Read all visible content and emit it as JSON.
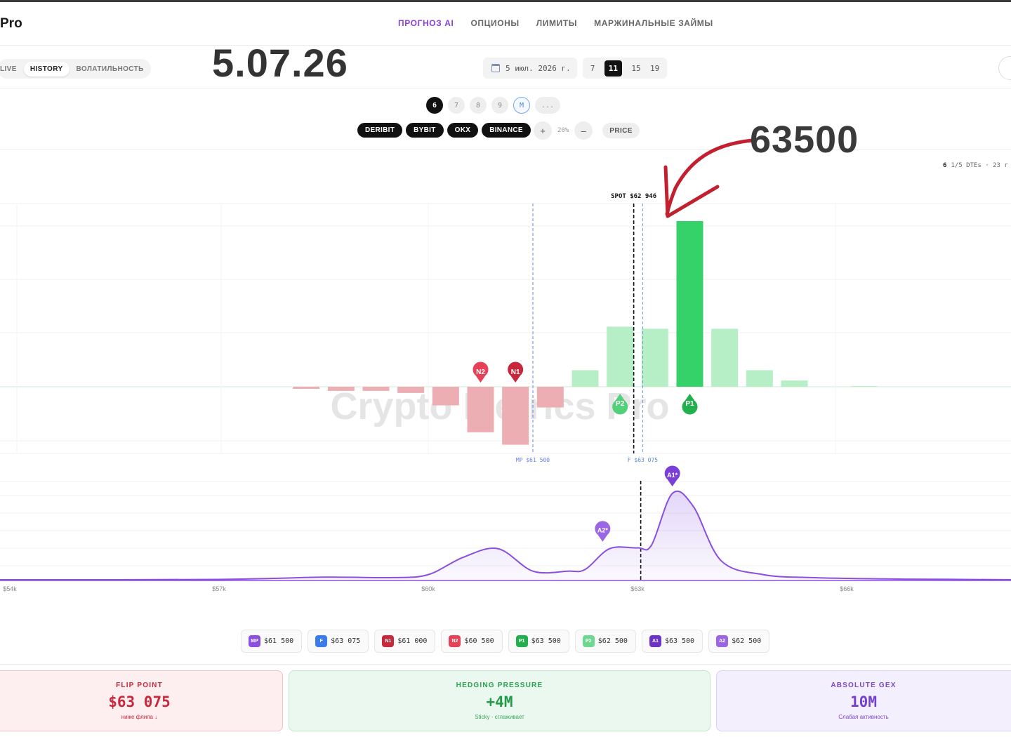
{
  "header": {
    "brand": "Pro",
    "nav": [
      "ПРОГНОЗ AI",
      "ОПЦИОНЫ",
      "ЛИМИТЫ",
      "МАРЖИНАЛЬНЫЕ ЗАЙМЫ"
    ]
  },
  "toolbar": {
    "mode_tabs": [
      "LIVE",
      "HISTORY",
      "ВОЛАТИЛЬНОСТЬ"
    ],
    "overlay_date": "5.07.26",
    "date_value": "5 июл. 2026 г.",
    "days": [
      "7",
      "11",
      "15",
      "19"
    ]
  },
  "controls": {
    "dte_options": [
      "6",
      "7",
      "8",
      "9",
      "M",
      "..."
    ],
    "exchanges": [
      "DERIBIT",
      "BYBIT",
      "OKX",
      "BINANCE"
    ],
    "zoom_plus": "+",
    "zoom_value": "20%",
    "zoom_minus": "–",
    "price_label": "PRICE",
    "meta_dte": "6",
    "meta_text": "1/5 DTEs · 23 r"
  },
  "annotation": {
    "value": "63500"
  },
  "chart_data": {
    "type": "bar",
    "x_unit": "USD strike",
    "x_ticks": [
      54000,
      57000,
      60000,
      63000,
      66000
    ],
    "x_tick_labels": [
      "$54k",
      "$57k",
      "$60k",
      "$63k",
      "$66k"
    ],
    "gex_bars": [
      {
        "strike": 58250,
        "value": -1
      },
      {
        "strike": 58750,
        "value": -2
      },
      {
        "strike": 59250,
        "value": -2
      },
      {
        "strike": 59750,
        "value": -3
      },
      {
        "strike": 60250,
        "value": -9
      },
      {
        "strike": 60750,
        "value": -22
      },
      {
        "strike": 61250,
        "value": -28
      },
      {
        "strike": 61750,
        "value": -10
      },
      {
        "strike": 62250,
        "value": 8
      },
      {
        "strike": 62750,
        "value": 29
      },
      {
        "strike": 63250,
        "value": 28
      },
      {
        "strike": 63750,
        "value": 80
      },
      {
        "strike": 64250,
        "value": 28
      },
      {
        "strike": 64750,
        "value": 8
      },
      {
        "strike": 65250,
        "value": 3
      },
      {
        "strike": 66250,
        "value": 0.3
      }
    ],
    "markers": {
      "spot": {
        "label": "SPOT $62 946",
        "value": 62946
      },
      "max_pain": {
        "label": "MP $61 500",
        "value": 61500
      },
      "flip": {
        "label": "F $63 075",
        "value": 63075
      }
    },
    "pins": [
      {
        "id": "N2",
        "strike": 60750,
        "color": "#e64156"
      },
      {
        "id": "N1",
        "strike": 61250,
        "color": "#c8283c"
      },
      {
        "id": "P2",
        "strike": 62750,
        "color": "#52d07a"
      },
      {
        "id": "P1",
        "strike": 63750,
        "color": "#22b04e"
      }
    ],
    "activity_curve": [
      [
        54000,
        0.0
      ],
      [
        57000,
        0.4
      ],
      [
        58500,
        3
      ],
      [
        59500,
        2.5
      ],
      [
        60000,
        6
      ],
      [
        60500,
        26
      ],
      [
        61000,
        36
      ],
      [
        61500,
        10
      ],
      [
        62000,
        10
      ],
      [
        62250,
        12
      ],
      [
        62600,
        36
      ],
      [
        63000,
        37
      ],
      [
        63200,
        40
      ],
      [
        63500,
        100
      ],
      [
        63800,
        85
      ],
      [
        64200,
        22
      ],
      [
        64800,
        6
      ],
      [
        65500,
        2.5
      ],
      [
        66500,
        1
      ],
      [
        67500,
        0.5
      ]
    ],
    "activity_pins": [
      {
        "id": "A1*",
        "strike": 63500
      },
      {
        "id": "A2*",
        "strike": 62500
      }
    ],
    "watermark": "Crypto Metrics Pro"
  },
  "legend_chips": [
    {
      "tag": "MP",
      "value": "$61 500",
      "color": "#8a4fe0"
    },
    {
      "tag": "F",
      "value": "$63 075",
      "color": "#3b7bea"
    },
    {
      "tag": "N1",
      "value": "$61 000",
      "color": "#c8283c"
    },
    {
      "tag": "N2",
      "value": "$60 500",
      "color": "#e64156"
    },
    {
      "tag": "P1",
      "value": "$63 500",
      "color": "#22b04e"
    },
    {
      "tag": "P2",
      "value": "$62 500",
      "color": "#6cd890"
    },
    {
      "tag": "A1",
      "value": "$63 500",
      "color": "#6b34c6"
    },
    {
      "tag": "A2",
      "value": "$62 500",
      "color": "#9a66e4"
    }
  ],
  "cards": {
    "flip": {
      "label": "FLIP POINT",
      "value": "$63 075",
      "sub": "ниже флипа ↓"
    },
    "hedge": {
      "label": "HEDGING PRESSURE",
      "value": "+4M",
      "sub": "Sticky · сглаживает"
    },
    "gex": {
      "label": "ABSOLUTE GEX",
      "value": "10M",
      "sub": "Слабая активность"
    }
  }
}
